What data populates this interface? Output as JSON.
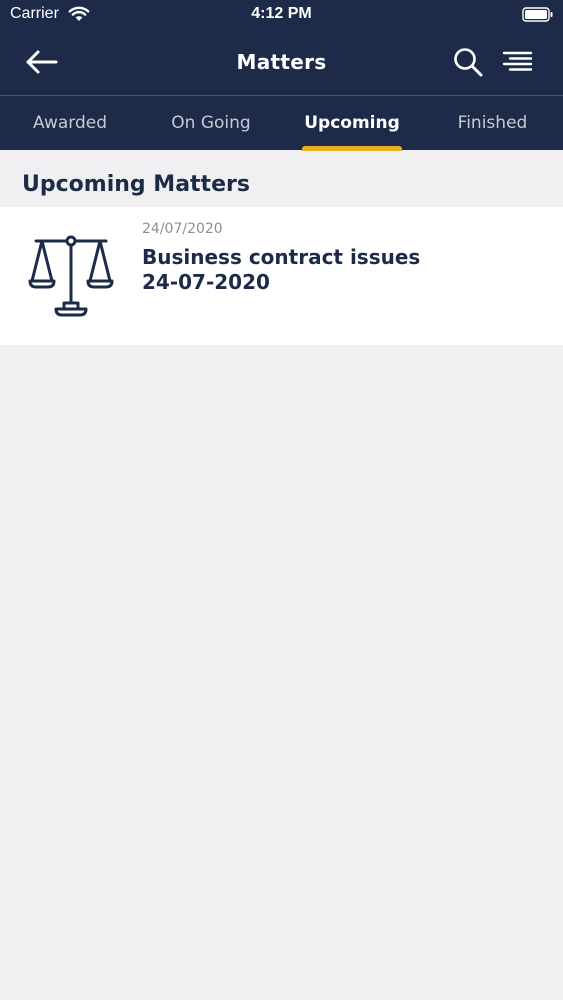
{
  "status_bar": {
    "carrier": "Carrier",
    "time": "4:12 PM"
  },
  "nav": {
    "title": "Matters",
    "back_icon": "arrow-left-icon",
    "search_icon": "search-icon",
    "menu_icon": "menu-lines-icon"
  },
  "tabs": [
    {
      "label": "Awarded",
      "active": false
    },
    {
      "label": "On Going",
      "active": false
    },
    {
      "label": "Upcoming",
      "active": true
    },
    {
      "label": "Finished",
      "active": false
    }
  ],
  "section": {
    "title": "Upcoming Matters"
  },
  "matters": [
    {
      "date": "24/07/2020",
      "title_line1": "Business contract issues",
      "title_line2": "24-07-2020",
      "icon": "scales-of-justice-icon"
    }
  ],
  "colors": {
    "header_bg": "#1d2b49",
    "accent": "#e9b022",
    "page_bg": "#f0eff1",
    "title_text": "#1d2b49",
    "muted_text": "#8c8f96"
  }
}
